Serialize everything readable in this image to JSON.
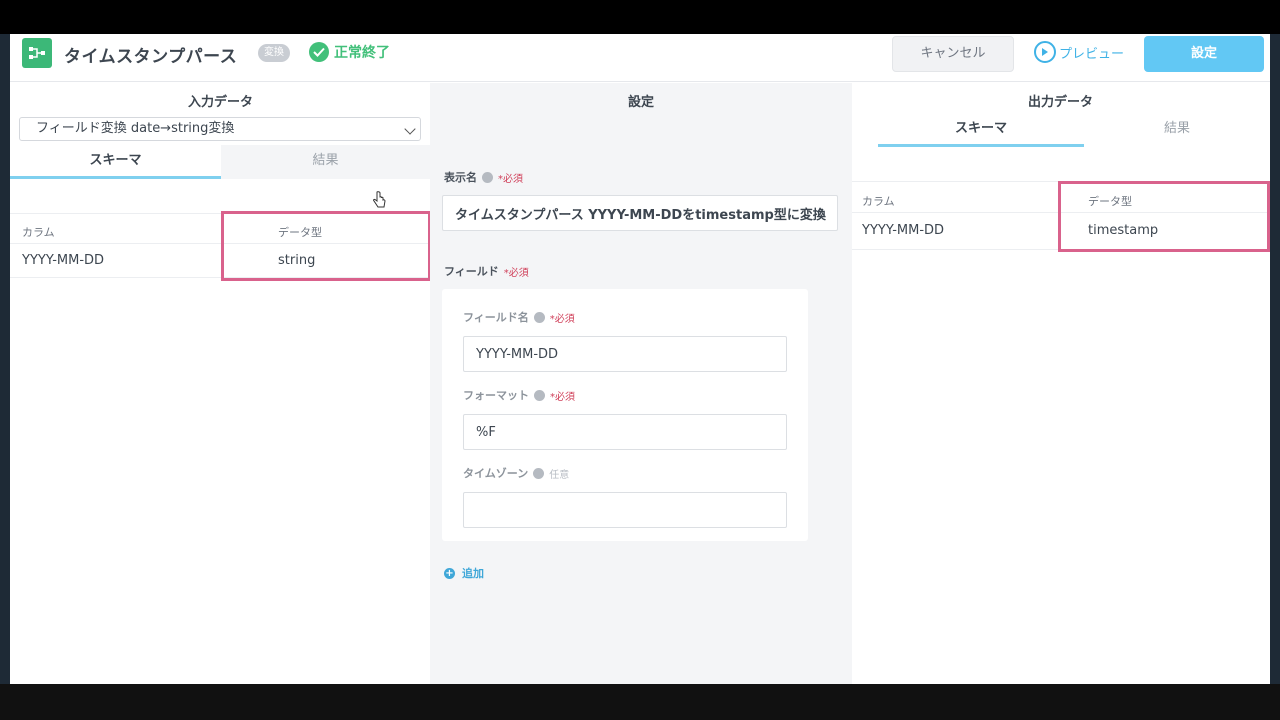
{
  "header": {
    "title": "タイムスタンプパース",
    "badge": "変換",
    "status": "正常終了",
    "cancel_label": "キャンセル",
    "preview_label": "プレビュー",
    "save_label": "設定"
  },
  "input_panel": {
    "title": "入力データ",
    "selected_source": "フィールド変換 date→string変換",
    "tabs": [
      "スキーマ",
      "結果"
    ],
    "columns": [
      "カラム",
      "データ型"
    ],
    "rows": [
      {
        "column": "YYYY-MM-DD",
        "type": "string"
      }
    ]
  },
  "settings_panel": {
    "title": "設定",
    "display_name_label": "表示名",
    "required_label": "*必須",
    "display_name_value": "タイムスタンプパース YYYY-MM-DDをtimestamp型に変換",
    "fields_label": "フィールド",
    "field_name_label": "フィールド名",
    "field_name_value": "YYYY-MM-DD",
    "format_label": "フォーマット",
    "format_value": "%F",
    "timezone_label": "タイムゾーン",
    "optional_label": "任意",
    "timezone_value": "",
    "add_label": "追加"
  },
  "output_panel": {
    "title": "出力データ",
    "tabs": [
      "スキーマ",
      "結果"
    ],
    "columns": [
      "カラム",
      "データ型"
    ],
    "rows": [
      {
        "column": "YYYY-MM-DD",
        "type": "timestamp"
      }
    ]
  },
  "colors": {
    "accent": "#62c8f4",
    "success": "#42c07a",
    "highlight": "#d9628c",
    "required": "#d0405a"
  }
}
